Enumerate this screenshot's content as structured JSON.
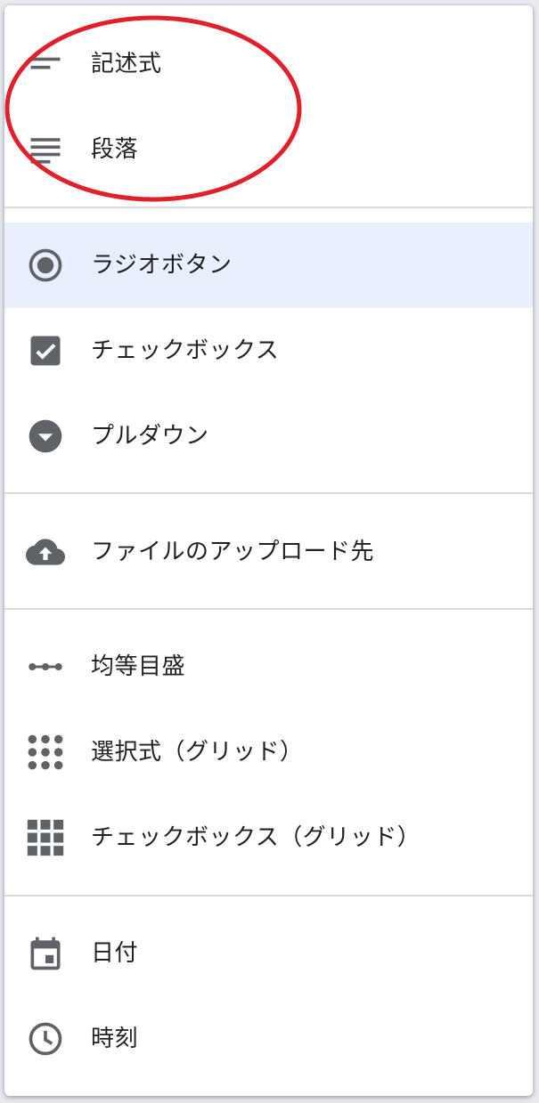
{
  "menu": {
    "items": [
      {
        "label": "記述式",
        "icon": "short-answer-icon"
      },
      {
        "label": "段落",
        "icon": "paragraph-icon"
      },
      {
        "label": "ラジオボタン",
        "icon": "radio-button-icon",
        "selected": true
      },
      {
        "label": "チェックボックス",
        "icon": "checkbox-icon"
      },
      {
        "label": "プルダウン",
        "icon": "dropdown-icon"
      },
      {
        "label": "ファイルのアップロード先",
        "icon": "cloud-upload-icon"
      },
      {
        "label": "均等目盛",
        "icon": "linear-scale-icon"
      },
      {
        "label": "選択式（グリッド）",
        "icon": "multiple-choice-grid-icon"
      },
      {
        "label": "チェックボックス（グリッド）",
        "icon": "checkbox-grid-icon"
      },
      {
        "label": "日付",
        "icon": "calendar-icon"
      },
      {
        "label": "時刻",
        "icon": "clock-icon"
      }
    ]
  },
  "colors": {
    "icon": "#5f6368",
    "text": "#202124",
    "selected_background": "#e8f0fe",
    "divider": "#dadce0",
    "annotation": "#e0202a"
  }
}
